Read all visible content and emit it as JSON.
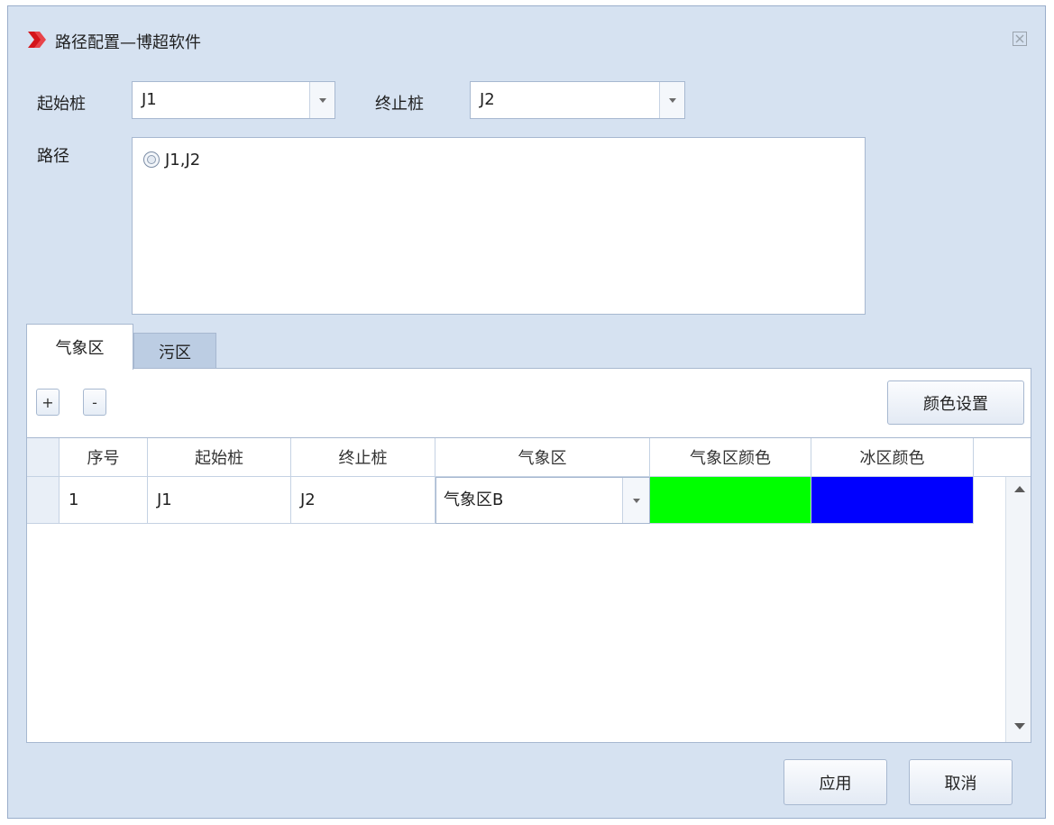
{
  "window": {
    "title": "路径配置—博超软件"
  },
  "start_pile": {
    "label": "起始桩",
    "value": "J1"
  },
  "end_pile": {
    "label": "终止桩",
    "value": "J2"
  },
  "path": {
    "label": "路径",
    "options": [
      "J1,J2"
    ]
  },
  "tabs": [
    {
      "label": "气象区",
      "active": true
    },
    {
      "label": "污区",
      "active": false
    }
  ],
  "toolbar": {
    "add_label": "+",
    "remove_label": "-",
    "color_settings_label": "颜色设置"
  },
  "table": {
    "columns": [
      "序号",
      "起始桩",
      "终止桩",
      "气象区",
      "气象区颜色",
      "冰区颜色"
    ],
    "rows": [
      {
        "index": "1",
        "start": "J1",
        "end": "J2",
        "zone": "气象区B",
        "zone_color": "#00ff00",
        "ice_color": "#0000ff"
      }
    ]
  },
  "footer": {
    "apply_label": "应用",
    "cancel_label": "取消"
  }
}
